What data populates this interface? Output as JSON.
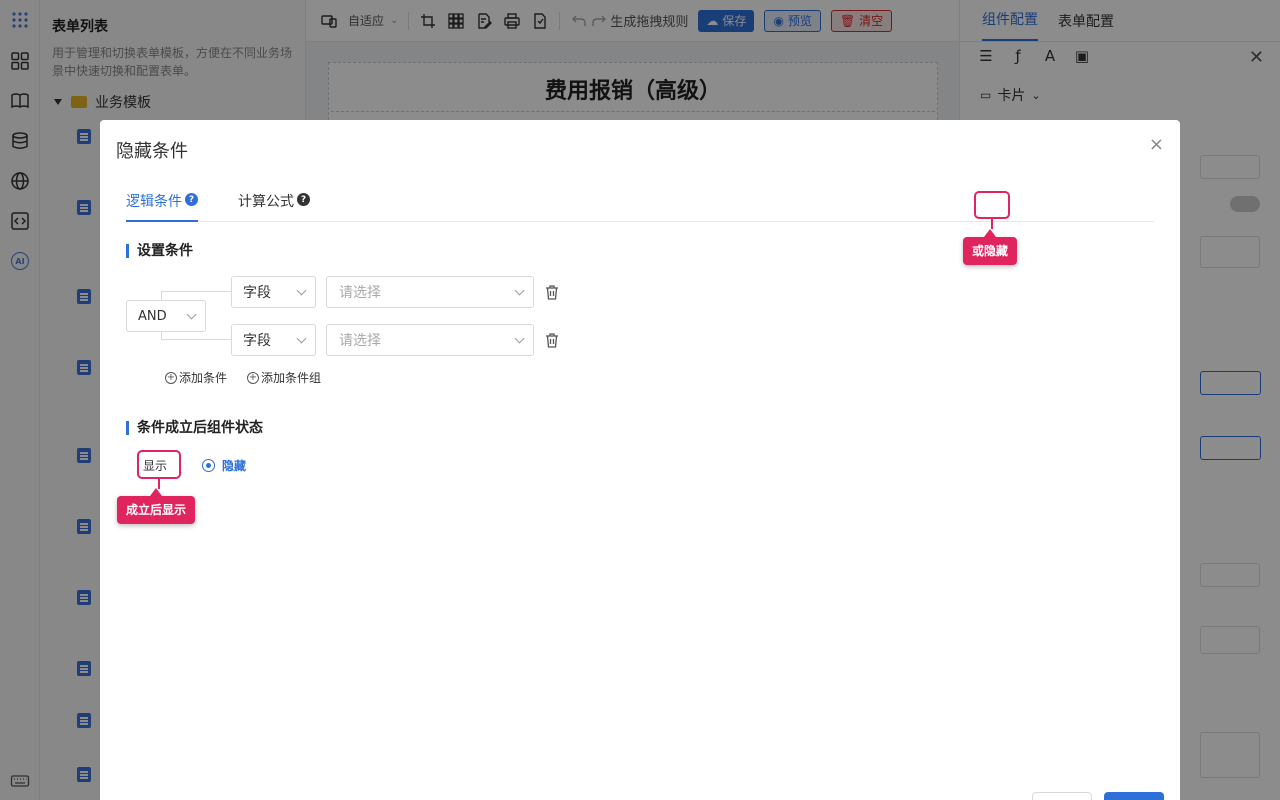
{
  "left_panel": {
    "title": "表单列表",
    "description": "用于管理和切换表单模板，方便在不同业务场景中快速切换和配置表单。",
    "folder": "业务模板"
  },
  "toolbar": {
    "fit_label": "自适应",
    "rules_label": "生成拖拽规则",
    "save_label": "保存",
    "preview_label": "预览",
    "clear_label": "清空"
  },
  "canvas": {
    "form_title": "费用报销（高级）"
  },
  "right_panel": {
    "tab_component": "组件配置",
    "tab_form": "表单配置",
    "card_label": "卡片"
  },
  "modal": {
    "title": "隐藏条件",
    "close": "×",
    "tabs": [
      {
        "label": "逻辑条件",
        "active": true
      },
      {
        "label": "计算公式",
        "active": false
      }
    ],
    "section_conditions": "设置条件",
    "logic_operator": "AND",
    "conditions": [
      {
        "field": "字段",
        "value_placeholder": "请选择"
      },
      {
        "field": "字段",
        "value_placeholder": "请选择"
      }
    ],
    "add_condition": "添加条件",
    "add_condition_group": "添加条件组",
    "section_state": "条件成立后组件状态",
    "state_options": [
      {
        "label": "显示",
        "selected": false
      },
      {
        "label": "隐藏",
        "selected": true
      }
    ]
  },
  "annotations": {
    "hide_callout": "或隐藏",
    "show_callout": "成立后显示"
  },
  "colors": {
    "primary": "#2f6fd9",
    "annotation": "#e0245e",
    "danger": "#d92c2c"
  }
}
